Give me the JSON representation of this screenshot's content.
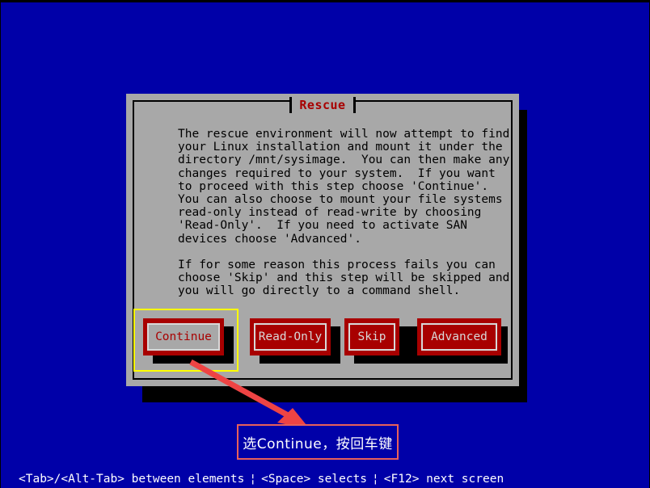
{
  "screen": {
    "background_color": "#0000a8"
  },
  "dialog": {
    "title": "Rescue",
    "title_color": "#a80000",
    "frame_color": "#a8a8a8",
    "body_text": "The rescue environment will now attempt to find\nyour Linux installation and mount it under the\ndirectory /mnt/sysimage.  You can then make any\nchanges required to your system.  If you want\nto proceed with this step choose 'Continue'.\nYou can also choose to mount your file systems\nread-only instead of read-write by choosing\n'Read-Only'.  If you need to activate SAN\ndevices choose 'Advanced'.\n\nIf for some reason this process fails you can\nchoose 'Skip' and this step will be skipped and\nyou will go directly to a command shell.",
    "buttons": [
      {
        "label": "Continue",
        "selected": true
      },
      {
        "label": "Read-Only",
        "selected": false
      },
      {
        "label": "Skip",
        "selected": false
      },
      {
        "label": "Advanced",
        "selected": false
      }
    ],
    "button_color": "#a80000",
    "focus_ring_color": "#ffff00"
  },
  "annotation": {
    "text": "选Continue，按回车键",
    "border_color": "#e8605a",
    "arrow_color": "#ee4444"
  },
  "statusbar": {
    "segment1": "<Tab>/<Alt-Tab> between elements",
    "separator": "¦",
    "segment2": "<Space> selects",
    "segment3": "<F12> next screen"
  }
}
